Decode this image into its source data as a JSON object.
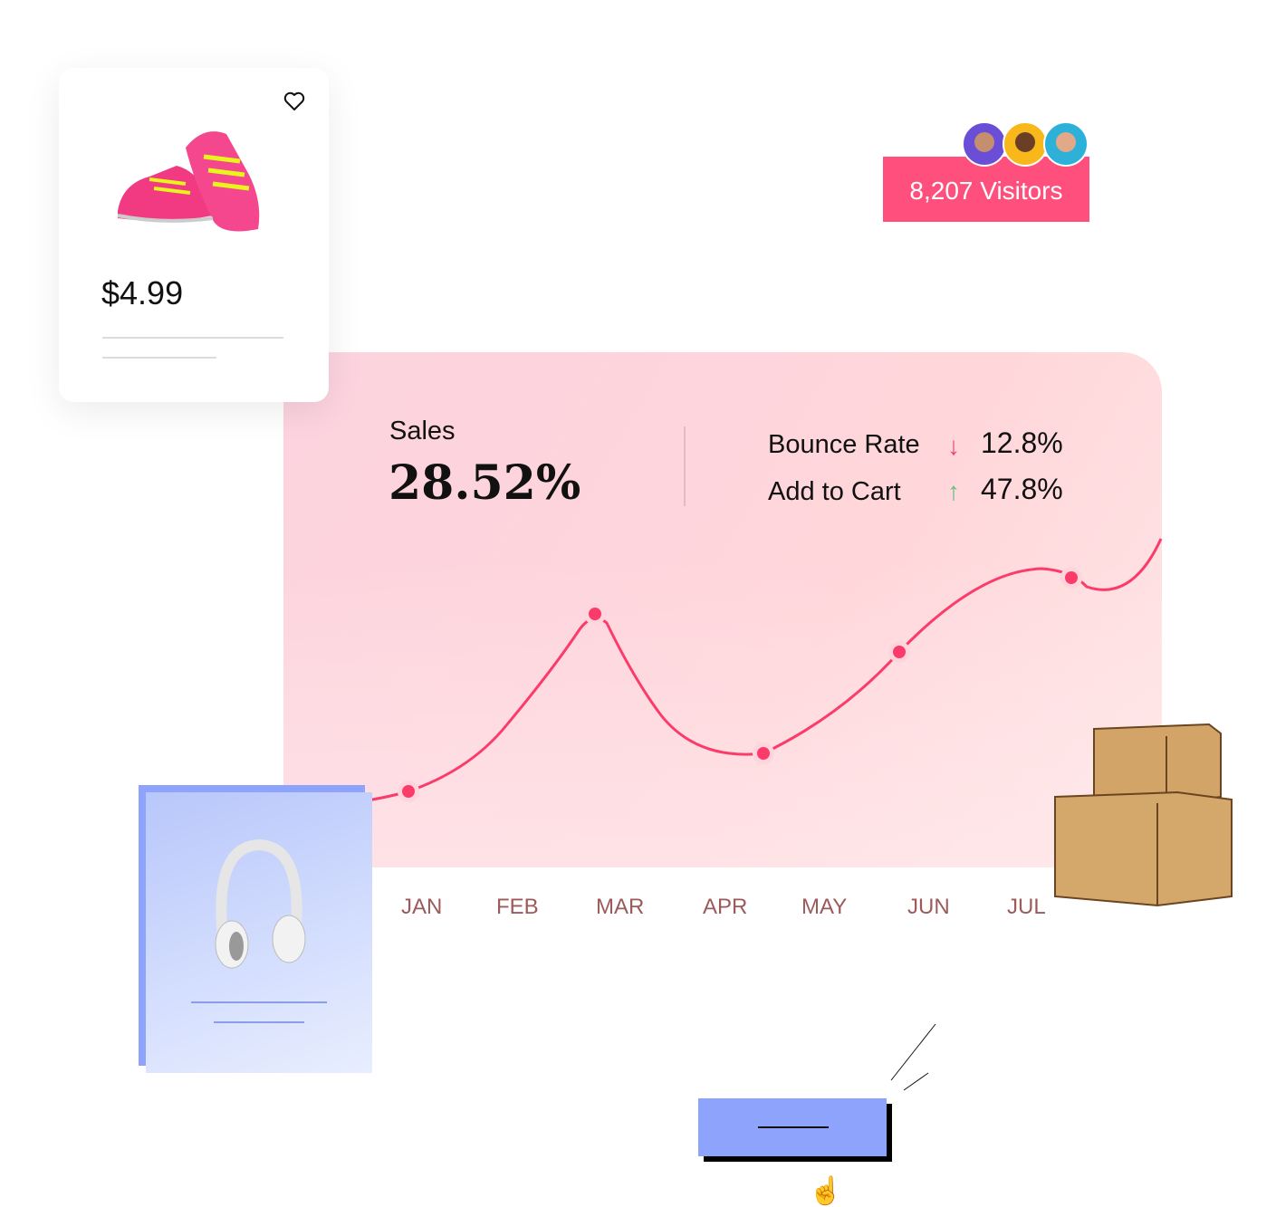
{
  "product": {
    "price": "$4.99",
    "favorite_icon": "heart-icon"
  },
  "visitors": {
    "label": "8,207 Visitors",
    "avatar_colors": [
      "#6a4fd6",
      "#f8b81c",
      "#2eb1d8"
    ],
    "badge_color": "#fe4f7d"
  },
  "stats": {
    "sales_label": "Sales",
    "sales_value": "28.52%",
    "metrics": [
      {
        "label": "Bounce Rate",
        "trend": "down",
        "value": "12.8%",
        "color": "#f0436c"
      },
      {
        "label": "Add to Cart",
        "trend": "up",
        "value": "47.8%",
        "color": "#5cbf82"
      }
    ]
  },
  "chart_data": {
    "type": "line",
    "categories": [
      "JAN",
      "FEB",
      "MAR",
      "APR",
      "MAY",
      "JUN",
      "JUL"
    ],
    "line_color": "#fb3b6a"
  }
}
